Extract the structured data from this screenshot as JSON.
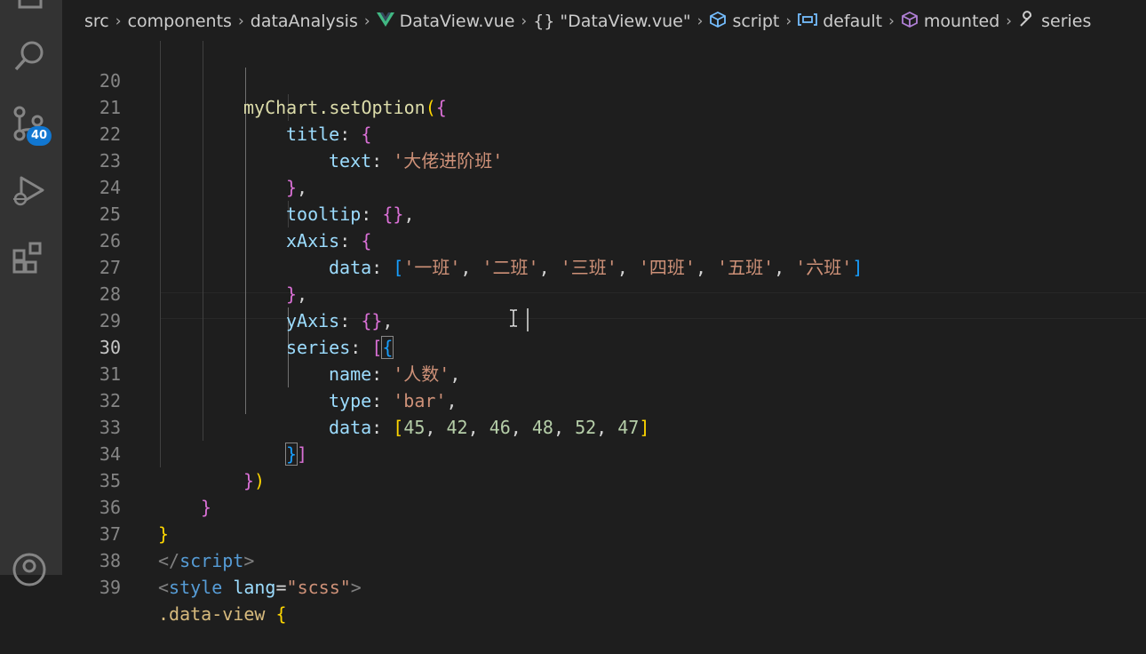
{
  "breadcrumb": {
    "items": [
      {
        "label": "src",
        "icon": ""
      },
      {
        "label": "components",
        "icon": ""
      },
      {
        "label": "dataAnalysis",
        "icon": ""
      },
      {
        "label": "DataView.vue",
        "icon": "vue-icon"
      },
      {
        "label": "\"DataView.vue\"",
        "icon": "braces-icon"
      },
      {
        "label": "script",
        "icon": "cube-icon"
      },
      {
        "label": "default",
        "icon": "variable-icon"
      },
      {
        "label": "mounted",
        "icon": "method-icon"
      },
      {
        "label": "series",
        "icon": "wrench-icon"
      }
    ]
  },
  "activity_bar": {
    "icons": [
      "explorer-icon",
      "search-icon",
      "source-control-icon",
      "run-debug-icon",
      "extensions-icon",
      "accounts-icon"
    ],
    "scm_badge": "40"
  },
  "editor": {
    "active_line": "30",
    "lines": [
      {
        "no": "20"
      },
      {
        "no": "21"
      },
      {
        "no": "22"
      },
      {
        "no": "23"
      },
      {
        "no": "24"
      },
      {
        "no": "25"
      },
      {
        "no": "26"
      },
      {
        "no": "27"
      },
      {
        "no": "28"
      },
      {
        "no": "29"
      },
      {
        "no": "30"
      },
      {
        "no": "31"
      },
      {
        "no": "32"
      },
      {
        "no": "33"
      },
      {
        "no": "34"
      },
      {
        "no": "35"
      },
      {
        "no": "36"
      },
      {
        "no": "37"
      },
      {
        "no": "38"
      },
      {
        "no": "39"
      }
    ],
    "code": {
      "l20_fn": "myChart.setOption",
      "l21_key": "title",
      "l22_key": "text",
      "l22_val": "'大佬进阶班'",
      "l24_key": "tooltip",
      "l25_key": "xAxis",
      "l26_key": "data",
      "l26_v1": "'一班'",
      "l26_v2": "'二班'",
      "l26_v3": "'三班'",
      "l26_v4": "'四班'",
      "l26_v5": "'五班'",
      "l26_v6": "'六班'",
      "l28_key": "yAxis",
      "l29_key": "series",
      "l30_key": "name",
      "l30_val": "'人数'",
      "l31_key": "type",
      "l31_val": "'bar'",
      "l32_key": "data",
      "l32_n1": "45",
      "l32_n2": "42",
      "l32_n3": "46",
      "l32_n4": "48",
      "l32_n5": "52",
      "l32_n6": "47",
      "l37_tag": "script",
      "l38_tag": "style",
      "l38_attr": "lang",
      "l38_val": "\"scss\"",
      "l39_sel": ".data-view"
    }
  },
  "colors": {
    "background": "#1e1e1e",
    "activity_bar": "#333333",
    "badge": "#1177d1",
    "keyword": "#569cd6",
    "property": "#9cdcfe",
    "string": "#ce9178",
    "number": "#b5cea8",
    "function": "#dcdcaa",
    "bracket_gold": "#ffd700",
    "bracket_purple": "#da70d6",
    "bracket_blue": "#179fff"
  }
}
